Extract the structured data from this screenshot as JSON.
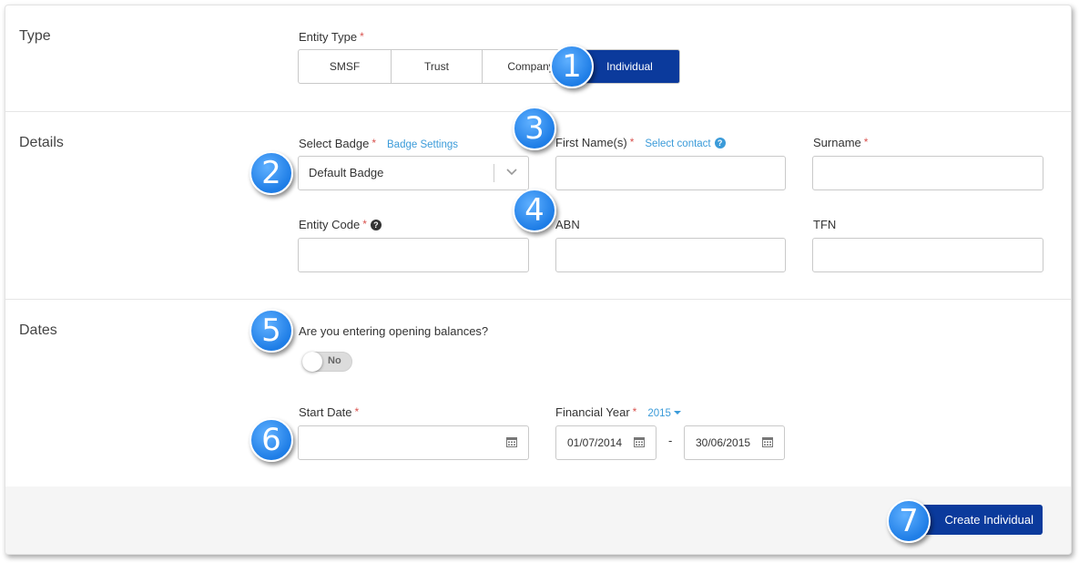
{
  "type_section": {
    "title": "Type",
    "entity_type_label": "Entity Type",
    "options": [
      "SMSF",
      "Trust",
      "Company",
      "Individual"
    ],
    "selected": "Individual"
  },
  "details_section": {
    "title": "Details",
    "select_badge_label": "Select Badge",
    "badge_settings_link": "Badge Settings",
    "badge_value": "Default Badge",
    "first_names_label": "First Name(s)",
    "select_contact_link": "Select contact",
    "surname_label": "Surname",
    "entity_code_label": "Entity Code",
    "abn_label": "ABN",
    "tfn_label": "TFN"
  },
  "dates_section": {
    "title": "Dates",
    "opening_balances_question": "Are you entering opening balances?",
    "toggle_label": "No",
    "start_date_label": "Start Date",
    "financial_year_label": "Financial Year",
    "financial_year_value": "2015",
    "fy_start": "01/07/2014",
    "fy_separator": "-",
    "fy_end": "30/06/2015"
  },
  "footer": {
    "create_button": "Create Individual"
  },
  "markers": [
    "1",
    "2",
    "3",
    "4",
    "5",
    "6",
    "7"
  ],
  "colors": {
    "primary": "#0b3a9c",
    "link": "#3b9bd9",
    "required": "#d9534f",
    "marker": "#1e7de6"
  }
}
